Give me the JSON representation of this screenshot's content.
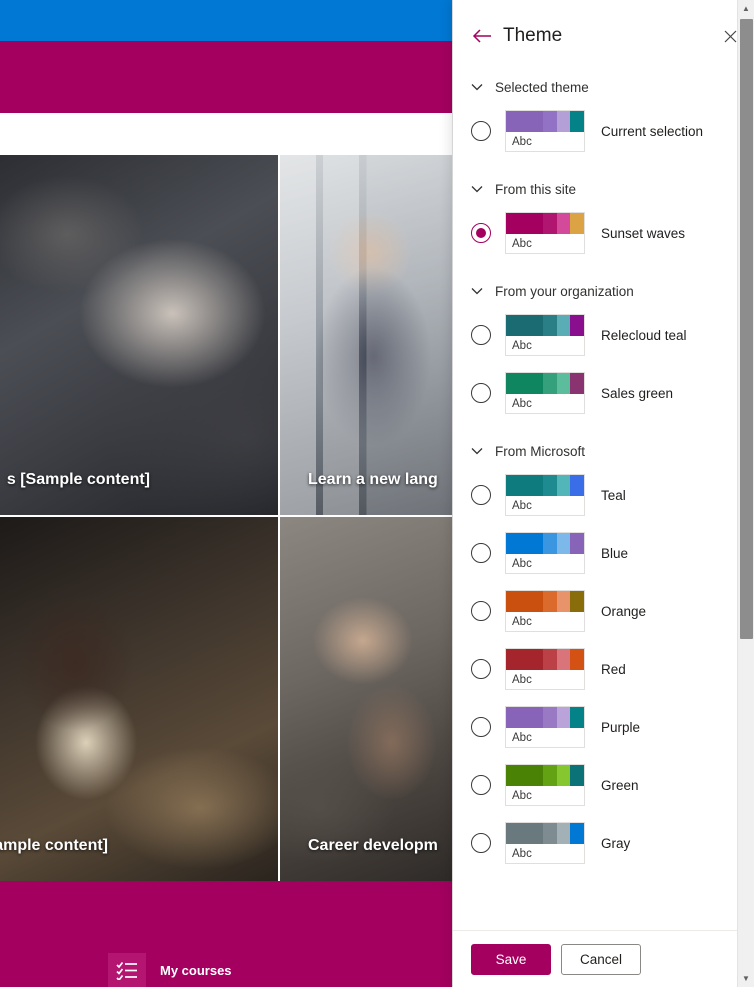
{
  "background_page": {
    "top_bar_color": "#0078d4",
    "band_color": "#a4005f",
    "cards": [
      {
        "title": "s [Sample content]",
        "image": "handshake-photo"
      },
      {
        "title": "Learn a new lang",
        "image": "office-meeting-photo"
      },
      {
        "title": "ample content]",
        "image": "desk-work-photo"
      },
      {
        "title": "Career developm",
        "image": "hands-together-photo"
      }
    ],
    "bottom_nav": {
      "label": "My courses",
      "icon": "checklist-icon"
    }
  },
  "panel": {
    "title": "Theme",
    "back_icon": "back-arrow-icon",
    "close_icon": "close-icon",
    "accent_color": "#a4005f",
    "sections": [
      {
        "label": "Selected theme",
        "themes": [
          {
            "name": "Current selection",
            "selected": false,
            "sample_text": "Abc",
            "colors": [
              "#8764b8",
              "#9272c4",
              "#b4a0d6",
              "#038387"
            ]
          }
        ]
      },
      {
        "label": "From this site",
        "themes": [
          {
            "name": "Sunset waves",
            "selected": true,
            "sample_text": "Abc",
            "colors": [
              "#a4005f",
              "#b01570",
              "#d34a9a",
              "#dba343"
            ]
          }
        ]
      },
      {
        "label": "From your organization",
        "themes": [
          {
            "name": "Relecloud teal",
            "selected": false,
            "sample_text": "Abc",
            "colors": [
              "#1b6b72",
              "#2a7f87",
              "#5aadb5",
              "#8a0f8f"
            ]
          },
          {
            "name": "Sales green",
            "selected": false,
            "sample_text": "Abc",
            "colors": [
              "#0f8560",
              "#35a07c",
              "#5bbd9b",
              "#8a3371"
            ]
          }
        ]
      },
      {
        "label": "From Microsoft",
        "themes": [
          {
            "name": "Teal",
            "selected": false,
            "sample_text": "Abc",
            "colors": [
              "#0e7b7f",
              "#1d8b8f",
              "#52b5b8",
              "#3a6ee8"
            ]
          },
          {
            "name": "Blue",
            "selected": false,
            "sample_text": "Abc",
            "colors": [
              "#0078d4",
              "#3a96e0",
              "#7db8ea",
              "#8764b8"
            ]
          },
          {
            "name": "Orange",
            "selected": false,
            "sample_text": "Abc",
            "colors": [
              "#ca5010",
              "#da6b2c",
              "#e8936a",
              "#8a6d0b"
            ]
          },
          {
            "name": "Red",
            "selected": false,
            "sample_text": "Abc",
            "colors": [
              "#a4262c",
              "#bb4146",
              "#d9757a",
              "#d35213"
            ]
          },
          {
            "name": "Purple",
            "selected": false,
            "sample_text": "Abc",
            "colors": [
              "#8764b8",
              "#9a79c4",
              "#b9a3d9",
              "#038387"
            ]
          },
          {
            "name": "Green",
            "selected": false,
            "sample_text": "Abc",
            "colors": [
              "#498205",
              "#63a212",
              "#86c62e",
              "#0b7378"
            ]
          },
          {
            "name": "Gray",
            "selected": false,
            "sample_text": "Abc",
            "colors": [
              "#69797e",
              "#7e8c91",
              "#a3b0b5",
              "#0078d4"
            ]
          }
        ]
      }
    ],
    "footer": {
      "save_label": "Save",
      "cancel_label": "Cancel"
    },
    "scrollbar": {
      "up_icon": "scroll-up-arrow-icon",
      "down_icon": "scroll-down-arrow-icon"
    }
  }
}
